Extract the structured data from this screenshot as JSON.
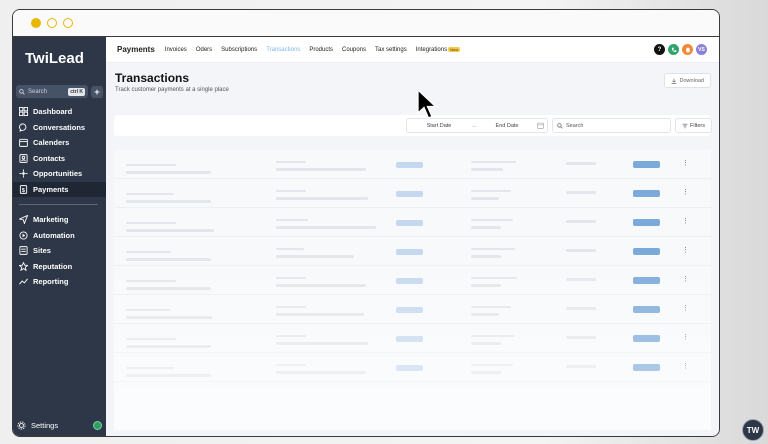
{
  "sidebar": {
    "logo_text": "TwiLead",
    "search_placeholder": "Search",
    "search_shortcut": "ctrl K",
    "items_top": [
      {
        "label": "Dashboard",
        "icon": "dashboard-icon"
      },
      {
        "label": "Conversations",
        "icon": "chat-icon"
      },
      {
        "label": "Calenders",
        "icon": "calendar-icon"
      },
      {
        "label": "Contacts",
        "icon": "contacts-icon"
      },
      {
        "label": "Opportunities",
        "icon": "opportunities-icon"
      },
      {
        "label": "Payments",
        "icon": "payments-icon",
        "active": true
      }
    ],
    "items_bottom": [
      {
        "label": "Marketing",
        "icon": "send-icon"
      },
      {
        "label": "Automation",
        "icon": "automation-icon"
      },
      {
        "label": "Sites",
        "icon": "sites-icon"
      },
      {
        "label": "Reputation",
        "icon": "star-icon"
      },
      {
        "label": "Reporting",
        "icon": "chart-icon"
      }
    ],
    "settings_label": "Settings"
  },
  "topnav": {
    "title": "Payments",
    "tabs": [
      "Invoices",
      "Oders",
      "Subscriptions",
      "Transactions",
      "Products",
      "Coupons",
      "Tax settings",
      "Integrations"
    ],
    "active_tab": "Transactions",
    "new_badge": "New",
    "avatar_initials": "VS"
  },
  "page": {
    "title": "Transactions",
    "subtitle": "Track customer payments at a single place",
    "download_label": "Download"
  },
  "filters": {
    "start_date_placeholder": "Start Date",
    "end_date_placeholder": "End Date",
    "search_placeholder": "Search",
    "filters_label": "Filters"
  },
  "table": {
    "row_count": 8,
    "row_menu_glyph": "⋮"
  },
  "colors": {
    "sidebar_bg": "#2d3748",
    "accent": "#7fb6e6",
    "titlebar_dot": "#e8b800"
  },
  "watermark_text": "TW"
}
